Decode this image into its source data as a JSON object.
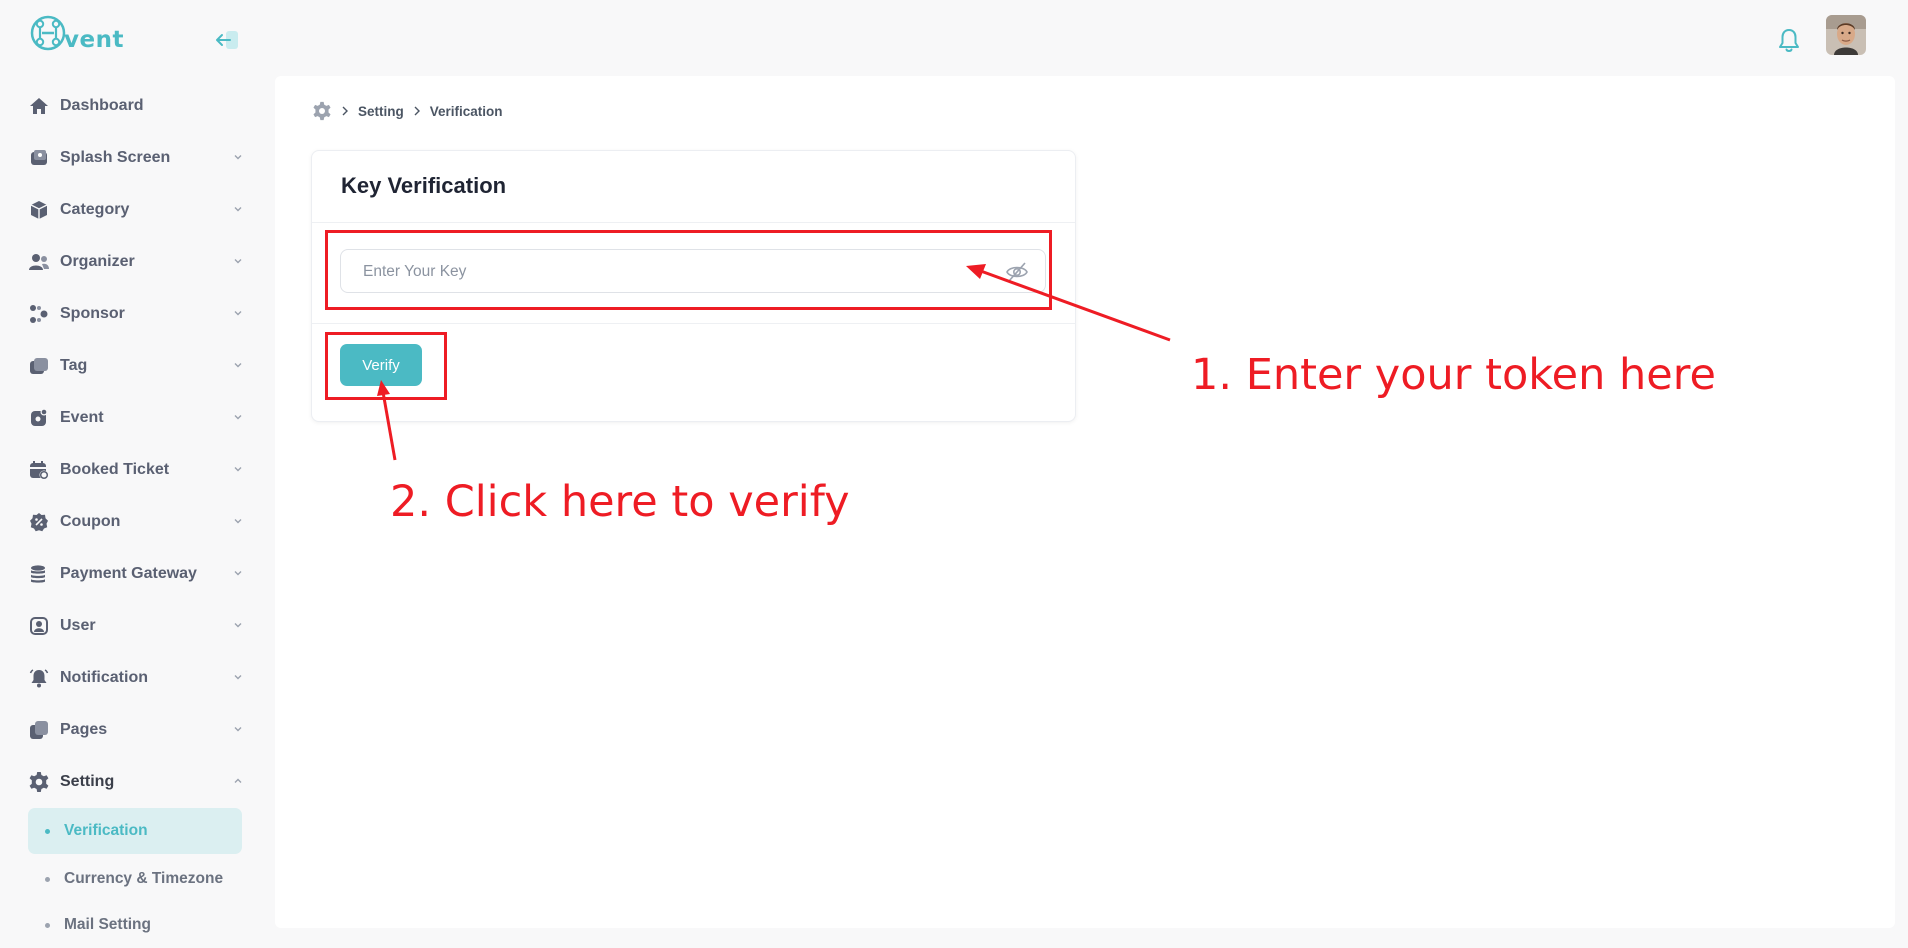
{
  "app": {
    "logo_text": "vent"
  },
  "sidebar": {
    "items": [
      {
        "label": "Dashboard",
        "icon": "home-icon",
        "has_chevron": false
      },
      {
        "label": "Splash Screen",
        "icon": "splash-icon",
        "has_chevron": true
      },
      {
        "label": "Category",
        "icon": "cube-icon",
        "has_chevron": true
      },
      {
        "label": "Organizer",
        "icon": "users-icon",
        "has_chevron": true
      },
      {
        "label": "Sponsor",
        "icon": "sponsor-icon",
        "has_chevron": true
      },
      {
        "label": "Tag",
        "icon": "tag-icon",
        "has_chevron": true
      },
      {
        "label": "Event",
        "icon": "event-icon",
        "has_chevron": true
      },
      {
        "label": "Booked Ticket",
        "icon": "calendar-icon",
        "has_chevron": true
      },
      {
        "label": "Coupon",
        "icon": "coupon-icon",
        "has_chevron": true
      },
      {
        "label": "Payment Gateway",
        "icon": "coins-icon",
        "has_chevron": true
      },
      {
        "label": "User",
        "icon": "user-icon",
        "has_chevron": true
      },
      {
        "label": "Notification",
        "icon": "bell-icon",
        "has_chevron": true
      },
      {
        "label": "Pages",
        "icon": "pages-icon",
        "has_chevron": true
      },
      {
        "label": "Setting",
        "icon": "gear-icon",
        "has_chevron": true,
        "expanded": true
      }
    ],
    "setting_subitems": [
      {
        "label": "Verification",
        "active": true
      },
      {
        "label": "Currency & Timezone",
        "active": false
      },
      {
        "label": "Mail Setting",
        "active": false
      }
    ]
  },
  "breadcrumb": {
    "items": [
      "Setting",
      "Verification"
    ]
  },
  "card": {
    "title": "Key Verification",
    "key_input": {
      "value": "",
      "placeholder": "Enter Your Key"
    },
    "verify_label": "Verify"
  },
  "annotations": {
    "step1": "1. Enter your token here",
    "step2": "2. Click here to verify"
  },
  "colors": {
    "accent": "#4bbac4",
    "annotation": "#ee1c24",
    "active_bg": "#dbeff1"
  }
}
